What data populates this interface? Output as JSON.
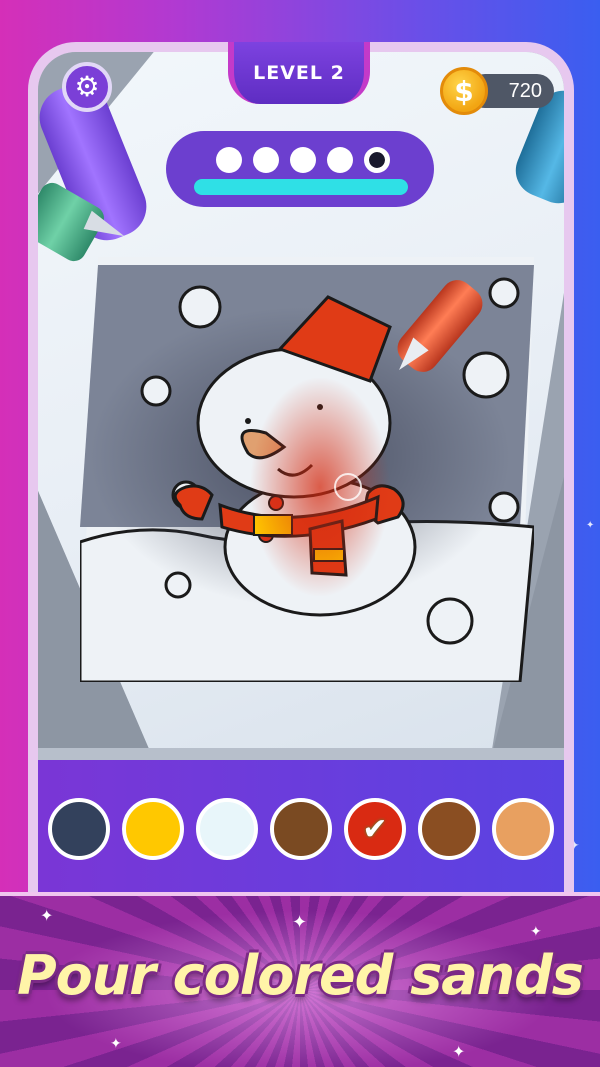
{
  "hud": {
    "level_label": "LEVEL 2",
    "coins": "720",
    "coin_symbol": "$",
    "settings_icon": "gear-icon"
  },
  "progress": {
    "steps_total": 5,
    "current_step": 5,
    "fill_fraction": 1.0
  },
  "palette": {
    "colors": [
      "#33415c",
      "#ffc800",
      "#e8f6fa",
      "#7a4a22",
      "#d92a12",
      "#8a4e22",
      "#e8a060"
    ],
    "selected_index": 4,
    "selected_icon": "check-icon"
  },
  "banner": {
    "text": "Pour colored sands"
  }
}
